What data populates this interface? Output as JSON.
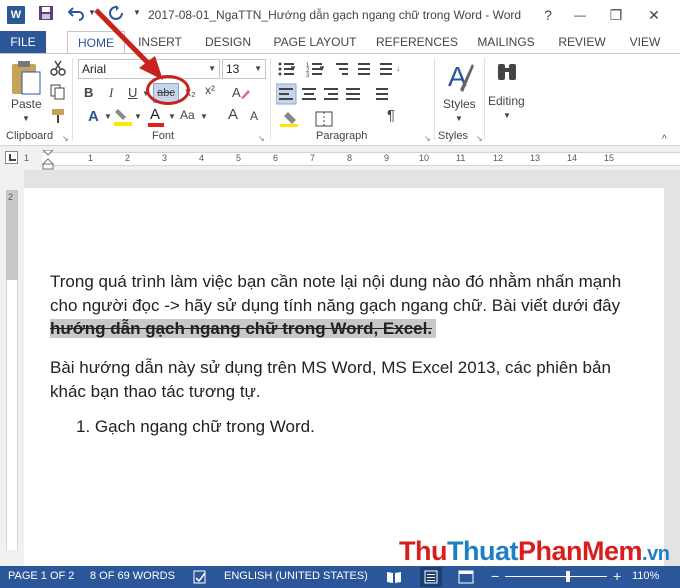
{
  "titlebar": {
    "logo": "W",
    "title": "2017-08-01_NgaTTN_Hướng dẫn gạch ngang chữ trong Word - Word",
    "help": "?",
    "min": "—",
    "restore": "❐",
    "close": "✕"
  },
  "tabs": [
    "FILE",
    "HOME",
    "INSERT",
    "DESIGN",
    "PAGE LAYOUT",
    "REFERENCES",
    "MAILINGS",
    "REVIEW",
    "VIEW"
  ],
  "ribbon": {
    "paste_label": "Paste",
    "font_name": "Arial",
    "font_size": "13",
    "bold": "B",
    "italic": "I",
    "underline": "U",
    "strike": "abc",
    "subscript": "x₂",
    "superscript": "x²",
    "font_color": "A",
    "change_case": "Aa",
    "grow": "A",
    "shrink": "A",
    "pilcrow": "¶",
    "styles_label": "Styles",
    "editing_label": "Editing",
    "groups": {
      "clipboard": "Clipboard",
      "font": "Font",
      "paragraph": "Paragraph",
      "styles": "Styles"
    }
  },
  "ruler": {
    "numbers": [
      "1",
      "1",
      "2",
      "3",
      "4",
      "5",
      "6",
      "7",
      "8",
      "9",
      "10",
      "11",
      "12",
      "13",
      "14",
      "15"
    ],
    "vnumber": "2"
  },
  "document": {
    "line1": "Trong quá trình làm việc bạn cần note lại nội dung nào đó nhằm nhấn mạnh",
    "line2": "cho người đọc -> hãy sử dụng tính năng gạch ngang chữ. Bài viết dưới đây",
    "line3": "hướng dẫn gạch ngang chữ trong Word, Excel.",
    "line4": "Bài hướng dẫn này sử dụng trên MS Word, MS Excel 2013, các phiên bản",
    "line5": "khác bạn thao tác tương tự.",
    "list_item": "1.  Gạch ngang chữ trong Word."
  },
  "statusbar": {
    "page": "PAGE 1 OF 2",
    "words": "8 OF 69 WORDS",
    "language": "ENGLISH (UNITED STATES)",
    "zoom_minus": "−",
    "zoom_plus": "+",
    "zoom": "110%"
  },
  "watermark": {
    "part1": "Thu",
    "part2": "Thuat",
    "part3": "PhanMem",
    "part4": ".vn"
  },
  "colors": {
    "accent": "#2b579a",
    "annotation": "#c9211e"
  }
}
